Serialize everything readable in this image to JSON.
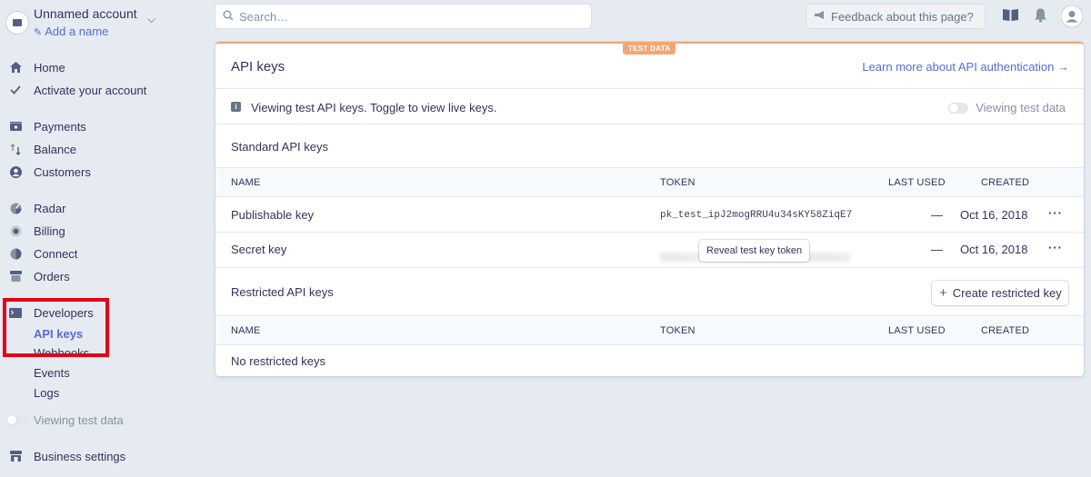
{
  "account": {
    "name": "Unnamed account",
    "add_name": "Add a name"
  },
  "nav": {
    "home": "Home",
    "activate": "Activate your account",
    "payments": "Payments",
    "balance": "Balance",
    "customers": "Customers",
    "radar": "Radar",
    "billing": "Billing",
    "connect": "Connect",
    "orders": "Orders",
    "developers": "Developers",
    "api_keys": "API keys",
    "webhooks": "Webhooks",
    "events": "Events",
    "logs": "Logs",
    "viewing_test_data": "Viewing test data",
    "business_settings": "Business settings"
  },
  "topbar": {
    "search_placeholder": "Search…",
    "feedback": "Feedback about this page?"
  },
  "card": {
    "badge": "TEST DATA",
    "title": "API keys",
    "learn_more": "Learn more about API authentication →",
    "info": "Viewing test API keys. Toggle to view live keys.",
    "viewing_test_data": "Viewing test data",
    "standard_title": "Standard API keys",
    "restricted_title": "Restricted API keys",
    "create_restricted": "Create restricted key",
    "no_restricted": "No restricted keys",
    "reveal": "Reveal test key token"
  },
  "table": {
    "headers": {
      "name": "NAME",
      "token": "TOKEN",
      "last_used": "LAST USED",
      "created": "CREATED"
    },
    "rows": [
      {
        "name": "Publishable key",
        "token": "pk_test_ipJ2mogRRU4u34sKY58ZiqE7",
        "last_used": "—",
        "created": "Oct 16, 2018"
      },
      {
        "name": "Secret key",
        "token": "",
        "last_used": "—",
        "created": "Oct 16, 2018"
      }
    ]
  },
  "colors": {
    "accent": "#556cd6",
    "test_badge": "#f5a676",
    "highlight": "#e2001a"
  }
}
